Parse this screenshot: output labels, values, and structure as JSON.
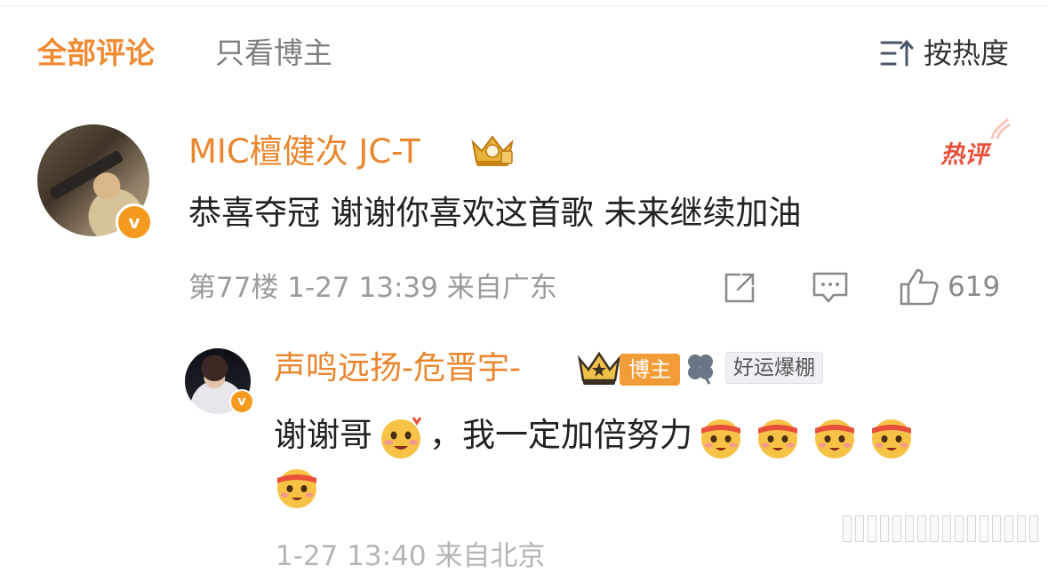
{
  "tabs": {
    "all_comments": "全部评论",
    "blogger_only": "只看博主"
  },
  "sort": {
    "label": "按热度",
    "icon": "sort-icon"
  },
  "comment": {
    "username": "MIC檀健次 JC-T",
    "verified_badge": "v",
    "hot_label": "热评",
    "text": "恭喜夺冠 谢谢你喜欢这首歌 未来继续加油",
    "floor_time_location": "第77楼 1-27 13:39 来自广东",
    "like_count": "619",
    "reply": {
      "username": "声鸣远扬-危晋宇-",
      "verified_badge": "v",
      "blogger_tag": "博主",
      "fan_badge": "好运爆棚",
      "text_part1": "谢谢哥",
      "text_part2": "，我一定加倍努力",
      "meta_partial": "1-27 13:40 来自北京"
    }
  },
  "colors": {
    "accent_orange": "#f08a33",
    "username_orange": "#e9862e",
    "hot_red": "#e8503a",
    "meta_gray": "#9b9b9b"
  }
}
